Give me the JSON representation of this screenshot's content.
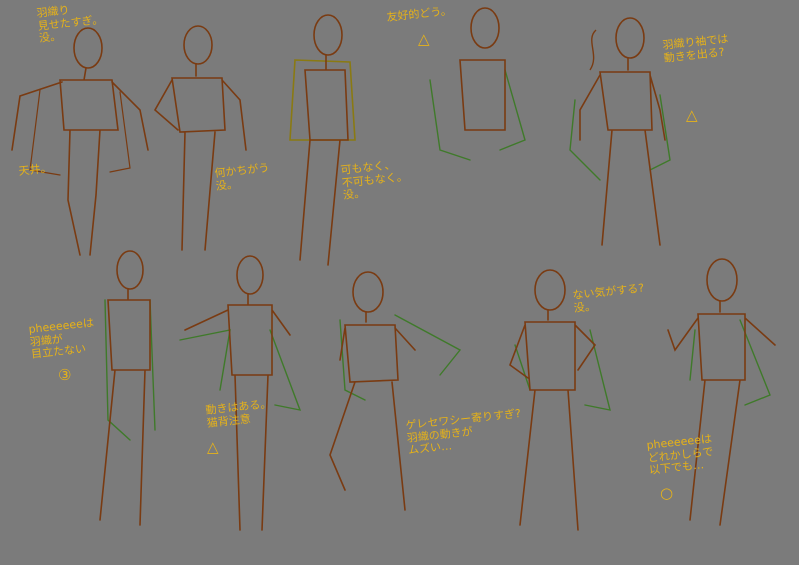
{
  "colors": {
    "background": "#7b7b7b",
    "pose_line": "#7a3b12",
    "green_layer": "#3f7a2a",
    "olive_layer": "#8a7a12",
    "note_text": "#e6b219"
  },
  "notes": {
    "n1": "羽織り\n見せたすぎ。\n没。",
    "n2": "天井。",
    "n3": "何かちがう\n没。",
    "n4": "可もなく、\n不可もなく。\n没。",
    "n5": "友好的どう。",
    "n6": "羽織り袖では\n動きを出る?",
    "n7": "pheeeeeeは\n羽織が\n目立たない",
    "n8": "動きはある。\n猫背注意",
    "n9": "ゲレセワシー寄りすぎ?\n羽織の動きが\nムズい…",
    "n10": "ない気がする?\n没。",
    "n11": "pheeeeeeは\nどれかしらで\n以下でも…"
  },
  "marks": {
    "m1": "△",
    "m2": "△",
    "m3": "③",
    "m4": "△",
    "m5": "○"
  }
}
